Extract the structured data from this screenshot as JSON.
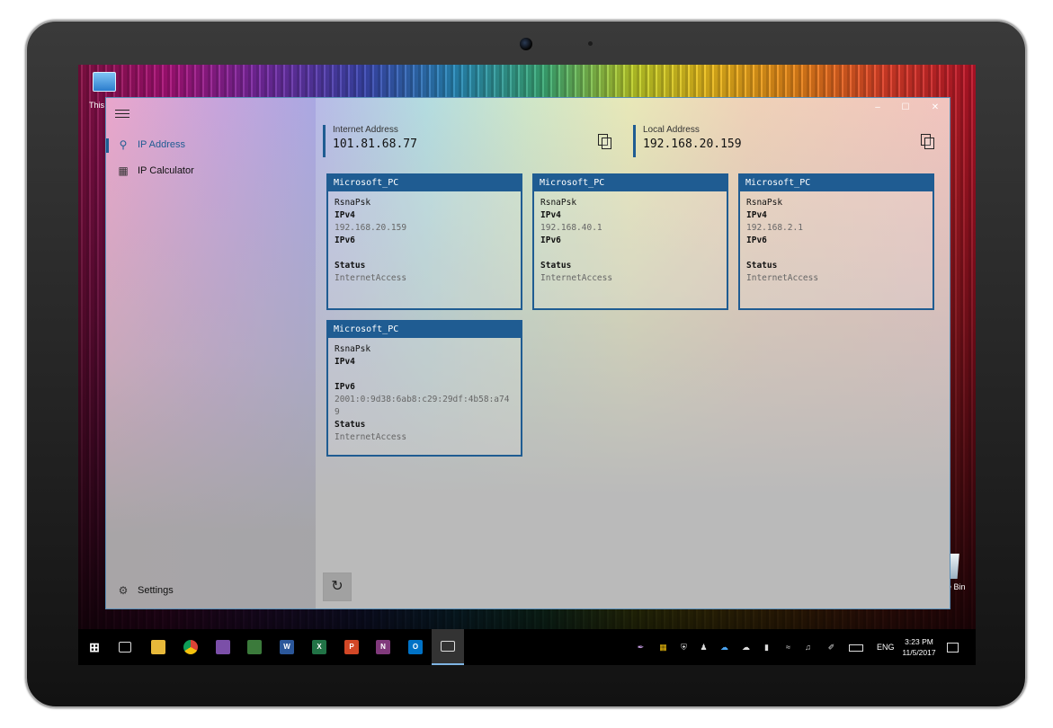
{
  "desktop": {
    "this_pc_label": "This",
    "recycle_bin_label": "e Bin"
  },
  "app": {
    "nav": {
      "items": [
        {
          "label": "IP Address",
          "icon": "search-icon",
          "selected": true
        },
        {
          "label": "IP Calculator",
          "icon": "calculator-icon",
          "selected": false
        }
      ],
      "settings_label": "Settings"
    },
    "internet": {
      "label": "Internet Address",
      "value": "101.81.68.77"
    },
    "local": {
      "label": "Local Address",
      "value": "192.168.20.159"
    },
    "cards": [
      {
        "name": "Microsoft_PC",
        "ssid": "RsnaPsk",
        "ipv4_label": "IPv4",
        "ipv4": "192.168.20.159",
        "ipv6_label": "IPv6",
        "ipv6": "",
        "status_label": "Status",
        "status": "InternetAccess"
      },
      {
        "name": "Microsoft_PC",
        "ssid": "RsnaPsk",
        "ipv4_label": "IPv4",
        "ipv4": "192.168.40.1",
        "ipv6_label": "IPv6",
        "ipv6": "",
        "status_label": "Status",
        "status": "InternetAccess"
      },
      {
        "name": "Microsoft_PC",
        "ssid": "RsnaPsk",
        "ipv4_label": "IPv4",
        "ipv4": "192.168.2.1",
        "ipv6_label": "IPv6",
        "ipv6": "",
        "status_label": "Status",
        "status": "InternetAccess"
      },
      {
        "name": "Microsoft_PC",
        "ssid": "RsnaPsk",
        "ipv4_label": "IPv4",
        "ipv4": "",
        "ipv6_label": "IPv6",
        "ipv6": "2001:0:9d38:6ab8:c29:29df:4b58:a749",
        "status_label": "Status",
        "status": "InternetAccess"
      }
    ],
    "accent_color": "#1f5c92"
  },
  "taskbar": {
    "pinned": [
      "windows-start-icon",
      "task-view-icon",
      "file-explorer-icon",
      "chrome-icon",
      "visual-studio-icon",
      "project-icon",
      "word-icon",
      "excel-icon",
      "powerpoint-icon",
      "onenote-icon",
      "outlook-icon",
      "ip-address-app-icon"
    ],
    "pinned_glyphs": {
      "word": "W",
      "excel": "X",
      "powerpoint": "P",
      "onenote": "N",
      "outlook": "O"
    },
    "language": "ENG",
    "time": "3:23 PM",
    "date": "11/5/2017"
  }
}
